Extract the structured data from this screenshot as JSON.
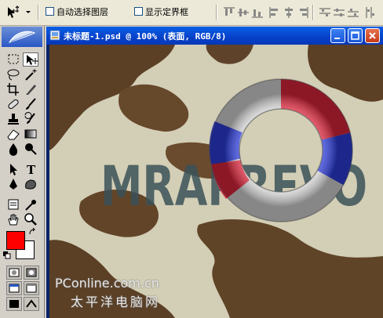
{
  "options_bar": {
    "auto_select_layer_label": "自动选择图层",
    "show_bounding_box_label": "显示定界框"
  },
  "document": {
    "title": "未标题-1.psd @ 100% (表面, RGB/8)"
  },
  "canvas": {
    "text_art": "MRAPREVO"
  },
  "toolbox": {
    "foreground_color": "#ff0000",
    "background_color": "#ffffff"
  },
  "watermark": {
    "line1": "PConline.com.cn",
    "line2": "太平洋电脑网"
  },
  "colors": {
    "titlebar": "#0a5fe6",
    "ring_red": "#d8243a",
    "ring_blue": "#2c3cd6"
  }
}
